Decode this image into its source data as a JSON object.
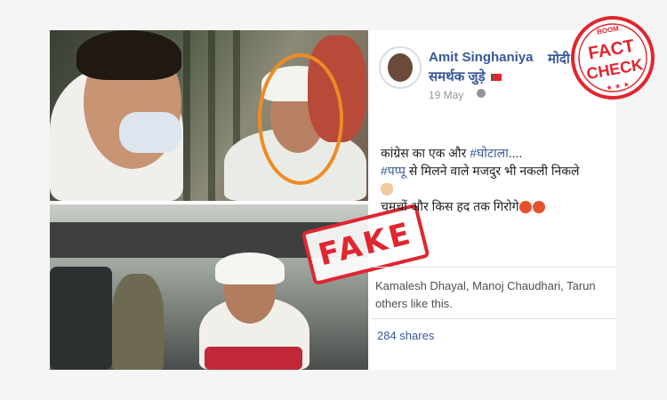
{
  "post": {
    "author": "Amit Singhaniya",
    "author_suffix": "मोदी",
    "group": "समर्थक जुड़े",
    "date": "19 May",
    "line1_prefix": "कांग्रेस का एक और ",
    "line1_hashtag": "#घोटाला",
    "line1_suffix": "....",
    "line2_hashtag": "#पप्पू",
    "line2_text": " से मिलने वाले मजदुर भी नकली निकले",
    "line3_text": "चमचों और किस हद तक गिरोगे",
    "likes_line1": "Kamalesh Dhayal, Manoj Chaudhari, Tarun",
    "likes_line2": "others like this.",
    "shares": "284 shares"
  },
  "stamp": {
    "fake_label": "FAKE"
  },
  "badge": {
    "brand": "BOOM",
    "line1": "FACT",
    "line2": "CHECK",
    "stars": "★ ★ ★"
  },
  "colors": {
    "accent_red": "#e0262f",
    "link_blue": "#385898",
    "highlight_orange": "#f08a24"
  },
  "icons": [
    "globe-icon",
    "flag-icon",
    "pointing-hand-icon",
    "angry-face-icon"
  ]
}
